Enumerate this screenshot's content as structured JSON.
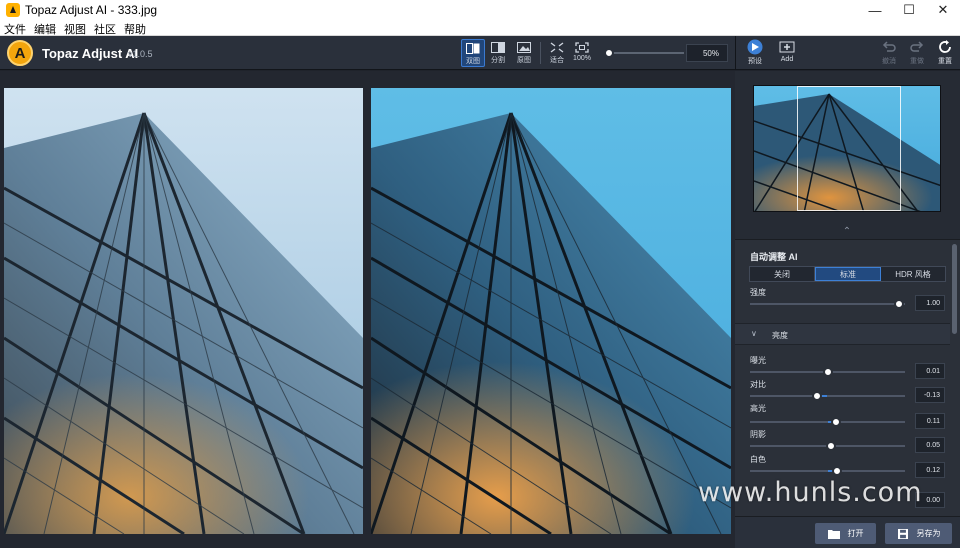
{
  "window": {
    "title": "Topaz Adjust AI - 333.jpg",
    "icon": "topaz-app-icon",
    "controls": [
      "minimize",
      "maximize",
      "close"
    ]
  },
  "menu": [
    "文件",
    "编辑",
    "视图",
    "社区",
    "帮助"
  ],
  "app": {
    "name": "Topaz Adjust AI",
    "version": "v1.0.5",
    "logo_letter": "A"
  },
  "toolbar": {
    "view_modes": [
      {
        "label": "双图",
        "icon": "dual-view-icon",
        "active": true
      },
      {
        "label": "分割",
        "icon": "split-view-icon",
        "active": false
      },
      {
        "label": "原图",
        "icon": "original-view-icon",
        "active": false
      }
    ],
    "fit_label": "适合",
    "actual_label": "100%",
    "zoom_value": "50%",
    "zoom_level": 0.0
  },
  "right_toolbar": {
    "preset_label": "预设",
    "add_label": "Add",
    "undo_label": "撤消",
    "redo_label": "重做",
    "reset_label": "重置"
  },
  "panel": {
    "auto_section_title": "自动调整 AI",
    "modes": [
      "关闭",
      "标准",
      "HDR 风格"
    ],
    "active_mode": "标准",
    "strength": {
      "label": "强度",
      "value": "1.00",
      "level": 0.96
    },
    "brightness_group": "亮度",
    "sliders": [
      {
        "label": "曝光",
        "value": "0.01",
        "level": 0.505
      },
      {
        "label": "对比",
        "value": "-0.13",
        "level": 0.435
      },
      {
        "label": "高光",
        "value": "0.11",
        "level": 0.555
      },
      {
        "label": "阴影",
        "value": "0.05",
        "level": 0.525
      },
      {
        "label": "白色",
        "value": "0.12",
        "level": 0.56
      }
    ],
    "partial_row_value": "0.00"
  },
  "bottom": {
    "open_label": "打开",
    "save_as_label": "另存为"
  },
  "watermark": "www.hunls.com",
  "colors": {
    "accent": "#3d80d6",
    "toolbar_bg": "#2a303b",
    "panel_bg": "#2b3039",
    "logo_orange": "#f3a50d"
  }
}
